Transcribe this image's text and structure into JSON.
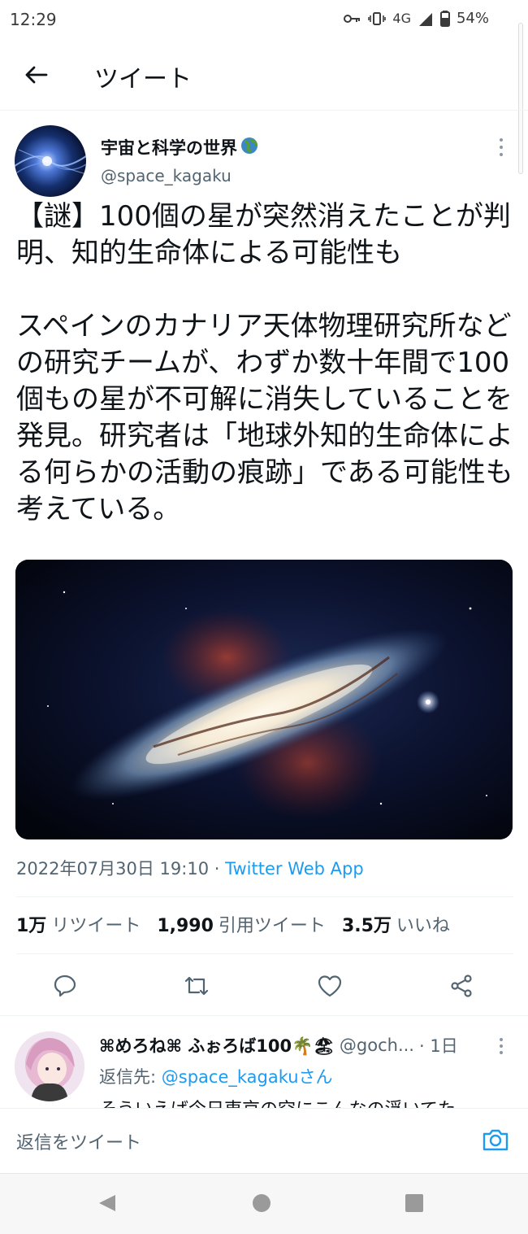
{
  "status_bar": {
    "time": "12:29",
    "network": "4G",
    "battery": "54%"
  },
  "header": {
    "title": "ツイート"
  },
  "tweet": {
    "author_name": "宇宙と科学の世界",
    "author_handle": "@space_kagaku",
    "paragraphs": [
      "【謎】100個の星が突然消えたことが判明、知的生命体による可能性も",
      "スペインのカナリア天体物理研究所などの研究チームが、わずか数十年間で100個もの星が不可解に消失していることを発見。研究者は「地球外知的生命体による何らかの活動の痕跡」である可能性も考えている。"
    ],
    "timestamp": "2022年07月30日 19:10",
    "separator": " · ",
    "source": "Twitter Web App",
    "stats": {
      "retweets_count": "1万",
      "retweets_label": "リツイート",
      "quotes_count": "1,990",
      "quotes_label": "引用ツイート",
      "likes_count": "3.5万",
      "likes_label": "いいね"
    }
  },
  "reply": {
    "name": "⌘めろね⌘ ふぉろば100🌴🏖",
    "handle": "@goch...",
    "time_sep": " · ",
    "time": "1日",
    "reply_to_label": "返信先: ",
    "reply_to_mention": "@space_kagakuさん",
    "text": "そういえば今日東京の空にこんなの浮いてた"
  },
  "compose": {
    "placeholder": "返信をツイート"
  },
  "icons": {
    "back": "arrow-left-icon",
    "more": "more-vertical-icon",
    "globe": "globe-emoji-icon",
    "reply": "speech-bubble-icon",
    "retweet": "retweet-icon",
    "like": "heart-icon",
    "share": "share-icon",
    "camera": "camera-icon"
  },
  "colors": {
    "accent": "#1d9bf0",
    "text": "#0f1419",
    "secondary": "#536471"
  }
}
